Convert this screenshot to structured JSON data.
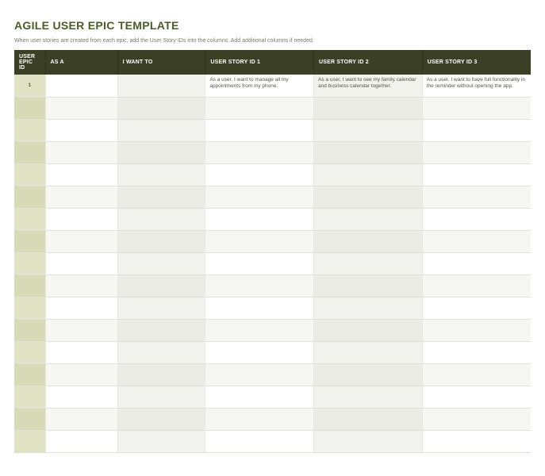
{
  "title": "AGILE USER EPIC TEMPLATE",
  "subtitle": "When user stories are created from each epic, add the User Story IDs into the columns. Add additional columns if needed.",
  "columns": {
    "epic_id": "USER EPIC ID",
    "as_a": "AS A",
    "i_want_to": "I WANT TO",
    "story1": "USER STORY ID 1",
    "story2": "USER STORY ID 2",
    "story3": "USER STORY ID 3"
  },
  "rows": [
    {
      "id": "1",
      "as_a": "",
      "i_want_to": "",
      "story1": "As a user, I want to manage all my appointments from my phone.",
      "story2": "As a user, I want to see my family calendar and business calendar together.",
      "story3": "As a user, I want to have full functionality in the reminder without opening the app."
    },
    {
      "id": "",
      "as_a": "",
      "i_want_to": "",
      "story1": "",
      "story2": "",
      "story3": ""
    },
    {
      "id": "",
      "as_a": "",
      "i_want_to": "",
      "story1": "",
      "story2": "",
      "story3": ""
    },
    {
      "id": "",
      "as_a": "",
      "i_want_to": "",
      "story1": "",
      "story2": "",
      "story3": ""
    },
    {
      "id": "",
      "as_a": "",
      "i_want_to": "",
      "story1": "",
      "story2": "",
      "story3": ""
    },
    {
      "id": "",
      "as_a": "",
      "i_want_to": "",
      "story1": "",
      "story2": "",
      "story3": ""
    },
    {
      "id": "",
      "as_a": "",
      "i_want_to": "",
      "story1": "",
      "story2": "",
      "story3": ""
    },
    {
      "id": "",
      "as_a": "",
      "i_want_to": "",
      "story1": "",
      "story2": "",
      "story3": ""
    },
    {
      "id": "",
      "as_a": "",
      "i_want_to": "",
      "story1": "",
      "story2": "",
      "story3": ""
    },
    {
      "id": "",
      "as_a": "",
      "i_want_to": "",
      "story1": "",
      "story2": "",
      "story3": ""
    },
    {
      "id": "",
      "as_a": "",
      "i_want_to": "",
      "story1": "",
      "story2": "",
      "story3": ""
    },
    {
      "id": "",
      "as_a": "",
      "i_want_to": "",
      "story1": "",
      "story2": "",
      "story3": ""
    },
    {
      "id": "",
      "as_a": "",
      "i_want_to": "",
      "story1": "",
      "story2": "",
      "story3": ""
    },
    {
      "id": "",
      "as_a": "",
      "i_want_to": "",
      "story1": "",
      "story2": "",
      "story3": ""
    },
    {
      "id": "",
      "as_a": "",
      "i_want_to": "",
      "story1": "",
      "story2": "",
      "story3": ""
    },
    {
      "id": "",
      "as_a": "",
      "i_want_to": "",
      "story1": "",
      "story2": "",
      "story3": ""
    },
    {
      "id": "",
      "as_a": "",
      "i_want_to": "",
      "story1": "",
      "story2": "",
      "story3": ""
    }
  ]
}
